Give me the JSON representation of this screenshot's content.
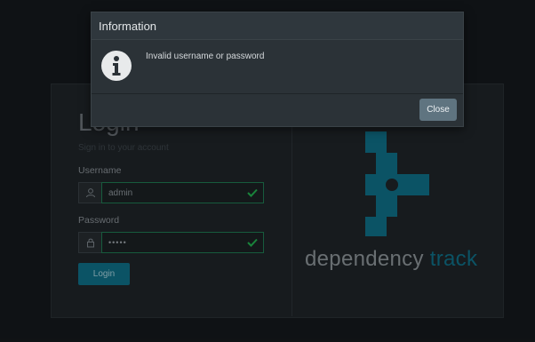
{
  "login": {
    "title": "Login",
    "subtitle": "Sign in to your account",
    "username_label": "Username",
    "username_value": "admin",
    "password_label": "Password",
    "password_value": "•••••",
    "button_label": "Login"
  },
  "brand": {
    "name_primary": "dependency",
    "name_accent": "track",
    "logo_color": "#0f6f87"
  },
  "modal": {
    "title": "Information",
    "message": "Invalid username or password",
    "close_label": "Close",
    "icon": "info-icon"
  },
  "colors": {
    "valid_border": "#1f7a52",
    "valid_check": "#22b04f",
    "primary_button": "#0f6f87"
  }
}
